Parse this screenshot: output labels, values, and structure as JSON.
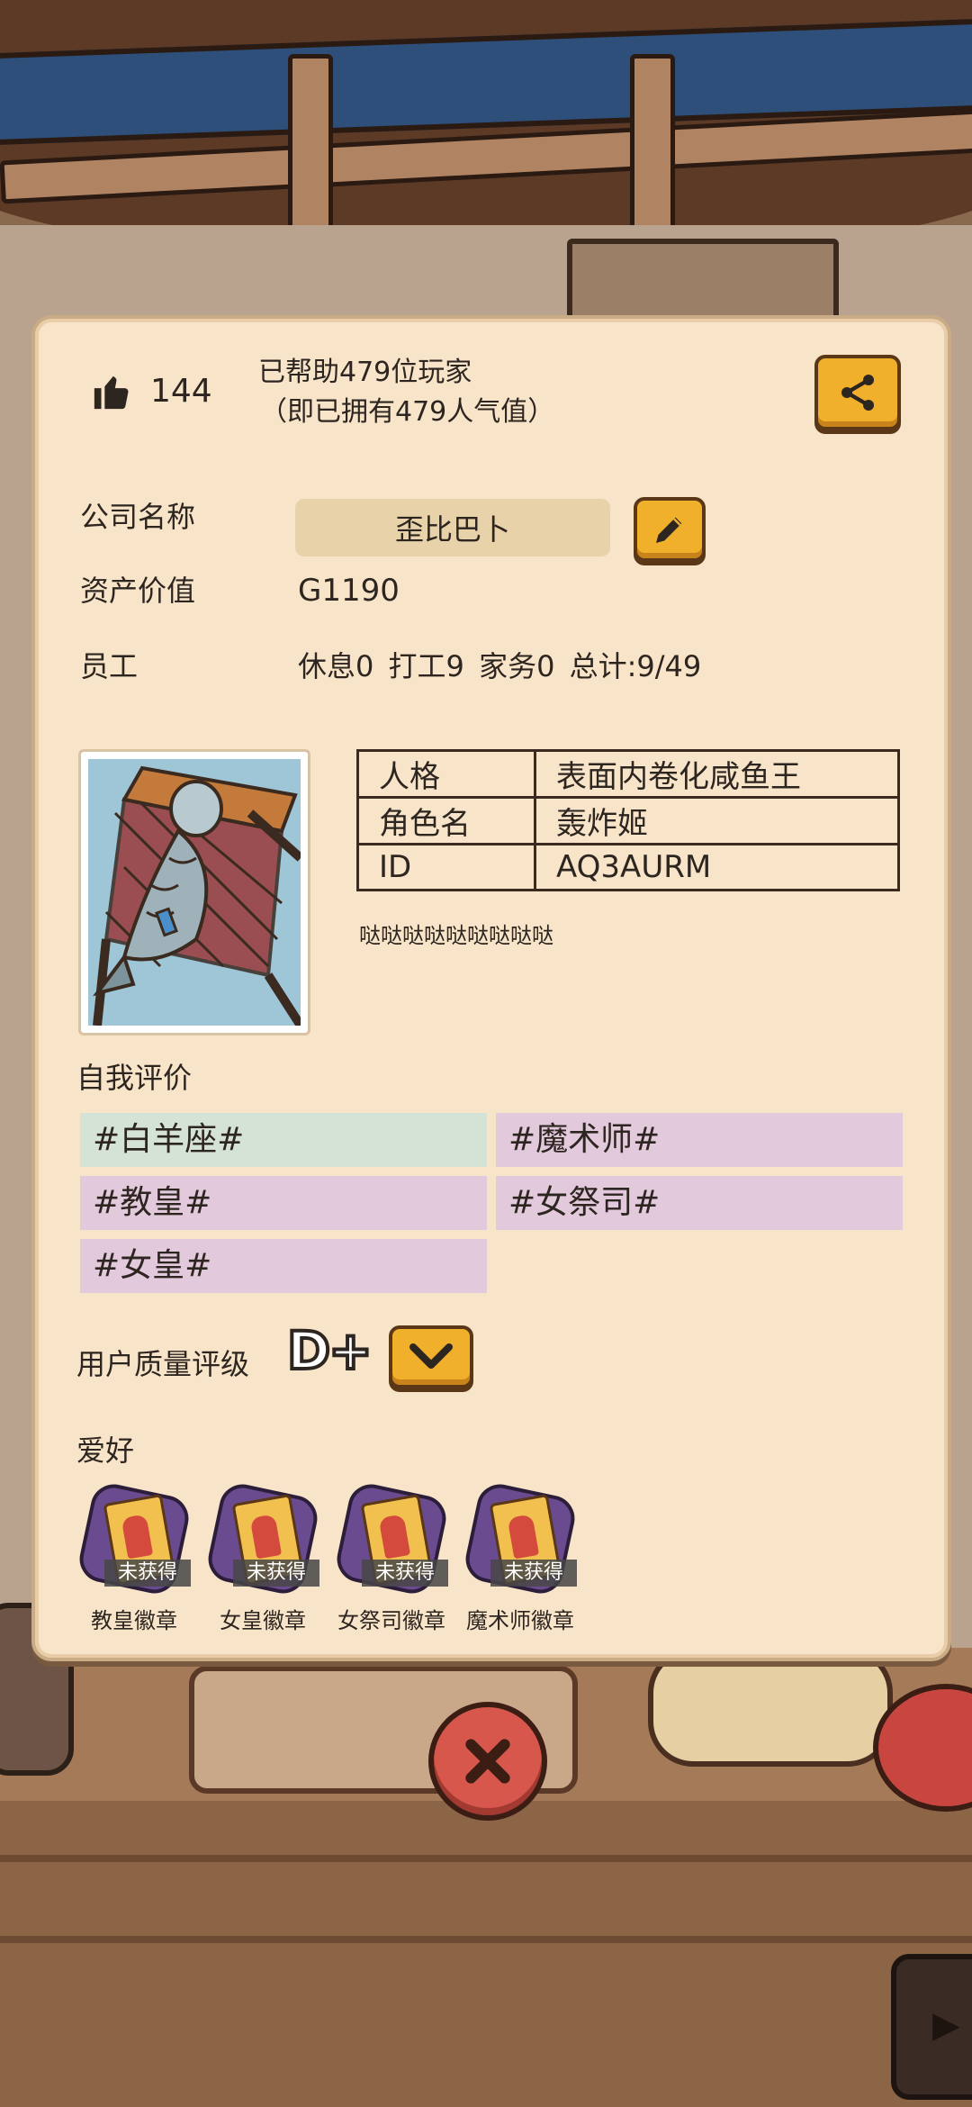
{
  "colors": {
    "panel": "#f8e4c9",
    "accent_button": "#f0b02c",
    "tag_green": "#d5e3d6",
    "tag_purple": "#e2c9dc",
    "close_button": "#d8574c"
  },
  "header": {
    "like_icon": "thumbs-up-icon",
    "like_count": "144",
    "helped_text": "已帮助479位玩家",
    "popularity_text": "（即已拥有479人气值）",
    "share_icon": "share-icon"
  },
  "company": {
    "name_label": "公司名称",
    "name_value": "歪比巴卜",
    "edit_icon": "pencil-icon",
    "asset_label": "资产价值",
    "asset_value": "G1190",
    "staff_label": "员工",
    "staff_stats": "休息0 打工9 家务0 总计:9/49"
  },
  "profile": {
    "rows": [
      {
        "key": "人格",
        "value": "表面内卷化咸鱼王"
      },
      {
        "key": "角色名",
        "value": "轰炸姬"
      },
      {
        "key": "ID",
        "value": "AQ3AURM"
      }
    ],
    "bio": "哒哒哒哒哒哒哒哒哒"
  },
  "self_evaluation": {
    "label": "自我评价",
    "tags": [
      "#白羊座#",
      "#魔术师#",
      "#教皇#",
      "#女祭司#",
      "#女皇#"
    ]
  },
  "rating": {
    "label": "用户质量评级",
    "grade": "D+",
    "toggle_icon": "chevron-down-icon"
  },
  "hobbies": {
    "label": "爱好",
    "badges": [
      {
        "status": "未获得",
        "name": "教皇徽章"
      },
      {
        "status": "未获得",
        "name": "女皇徽章"
      },
      {
        "status": "未获得",
        "name": "女祭司徽章"
      },
      {
        "status": "未获得",
        "name": "魔术师徽章"
      }
    ]
  },
  "close_icon": "close-icon"
}
